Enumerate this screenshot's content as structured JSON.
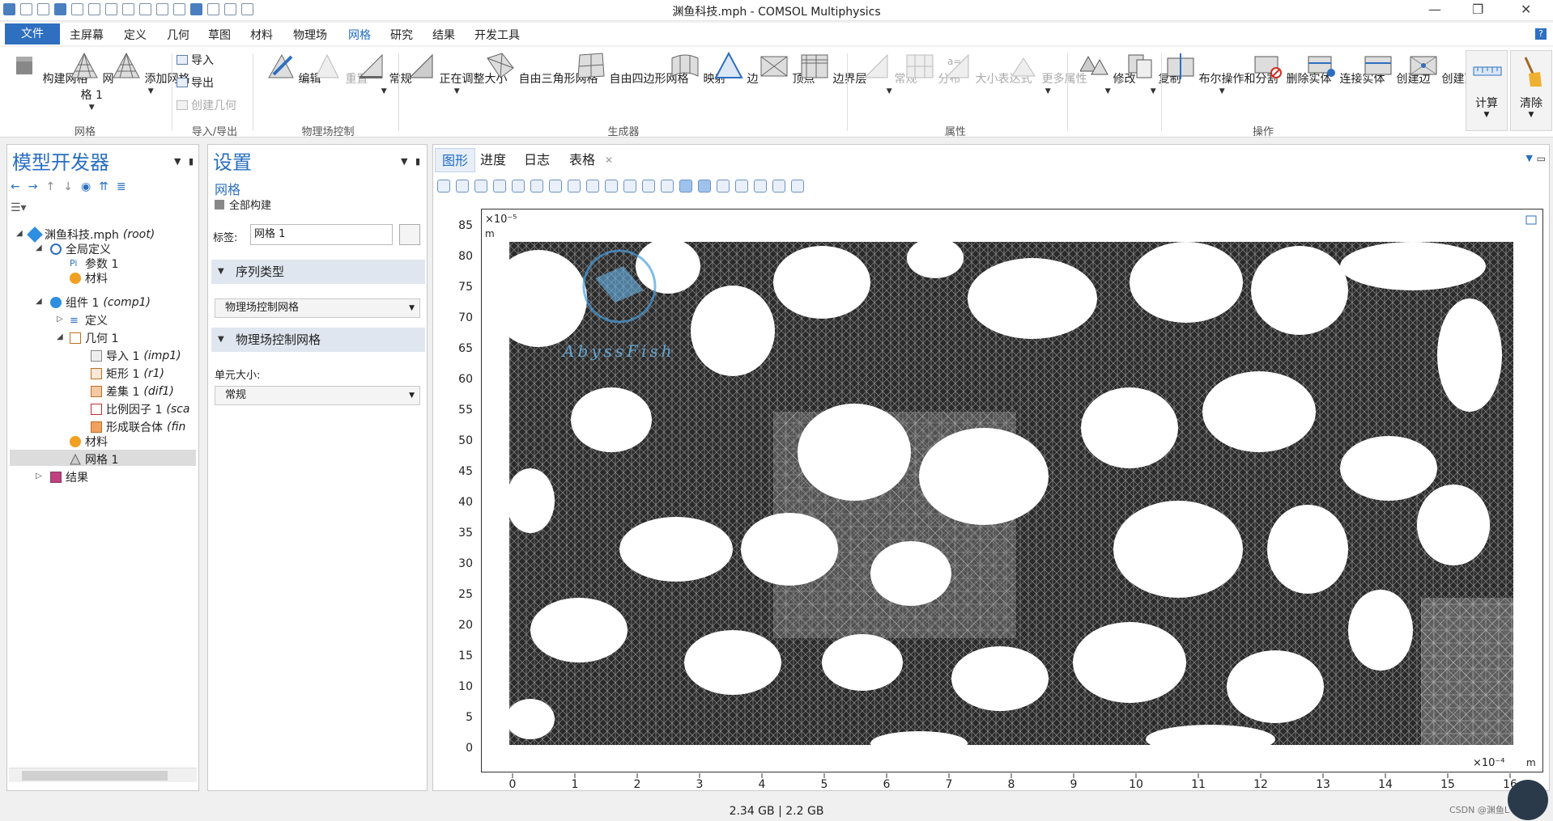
{
  "window": {
    "title": "渊鱼科技.mph - COMSOL Multiphysics",
    "min": "—",
    "restore": "❐",
    "close": "✕"
  },
  "menu": {
    "file": "文件",
    "items": [
      "主屏幕",
      "定义",
      "几何",
      "草图",
      "材料",
      "物理场",
      "网格",
      "研究",
      "结果",
      "开发工具"
    ],
    "help": "?"
  },
  "ribbon": {
    "build_mesh": "构建网格",
    "mesh1_a": "网",
    "mesh1_b": "格 1",
    "add_mesh": "添加网格",
    "import": "导入",
    "export": "导出",
    "create_geom": "创建几何",
    "edit": "编辑",
    "reset": "重置",
    "normal": "常规",
    "adjusting": "正在调整大小",
    "free_tri": "自由三角形网格",
    "free_quad": "自由四边形网格",
    "map": "映射",
    "edge": "边",
    "vertex": "顶点",
    "boundary_layer": "边界层",
    "p_normal": "常规",
    "distribution": "分布",
    "size_expr": "大小表达式",
    "more_props": "更多属性",
    "modify": "修改",
    "copy": "复制",
    "bool": "布尔操作和分割",
    "delete_entity": "删除实体",
    "connect_entity": "连接实体",
    "create_edge": "创建边",
    "create_vertex": "创建顶点",
    "compute": "计算",
    "clear": "清除",
    "groups": {
      "mesh": "网格",
      "import_export": "导入/导出",
      "physics": "物理场控制",
      "generators": "生成器",
      "attributes": "属性",
      "operations": "操作"
    }
  },
  "model_builder": {
    "title": "模型开发器",
    "tree": [
      {
        "label": "渊鱼科技.mph",
        "tag": "(root)"
      },
      {
        "label": "全局定义",
        "tag": ""
      },
      {
        "label": "参数 1",
        "tag": ""
      },
      {
        "label": "材料",
        "tag": ""
      },
      {
        "label": "组件 1",
        "tag": "(comp1)"
      },
      {
        "label": "定义",
        "tag": ""
      },
      {
        "label": "几何 1",
        "tag": ""
      },
      {
        "label": "导入 1",
        "tag": "(imp1)"
      },
      {
        "label": "矩形 1",
        "tag": "(r1)"
      },
      {
        "label": "差集 1",
        "tag": "(dif1)"
      },
      {
        "label": "比例因子 1",
        "tag": "(sca"
      },
      {
        "label": "形成联合体",
        "tag": "(fin"
      },
      {
        "label": "材料",
        "tag": ""
      },
      {
        "label": "网格 1",
        "tag": ""
      },
      {
        "label": "结果",
        "tag": ""
      }
    ]
  },
  "settings": {
    "title": "设置",
    "subtitle": "网格",
    "build_all": "全部构建",
    "label_caption": "标签:",
    "label_value": "网格 1",
    "sequence_type": "序列类型",
    "sequence_value": "物理场控制网格",
    "physics_section": "物理场控制网格",
    "element_size_label": "单元大小:",
    "element_size_value": "常规"
  },
  "graphics": {
    "tabs": [
      "图形",
      "进度",
      "日志",
      "表格"
    ],
    "watermark": "AbyssFish",
    "y_ticks": [
      "85",
      "80",
      "75",
      "70",
      "65",
      "60",
      "55",
      "50",
      "45",
      "40",
      "35",
      "30",
      "25",
      "20",
      "15",
      "10",
      "5",
      "0"
    ],
    "x_ticks": [
      "0",
      "1",
      "2",
      "3",
      "4",
      "5",
      "6",
      "7",
      "8",
      "9",
      "10",
      "11",
      "12",
      "13",
      "14",
      "15",
      "16"
    ],
    "y_exp": "×10⁻⁵",
    "y_unit": "m",
    "x_exp": "×10⁻⁴",
    "x_unit": "m"
  },
  "status": {
    "memory": "2.34 GB | 2.2 GB",
    "credit": "CSDN @渊鱼L"
  }
}
